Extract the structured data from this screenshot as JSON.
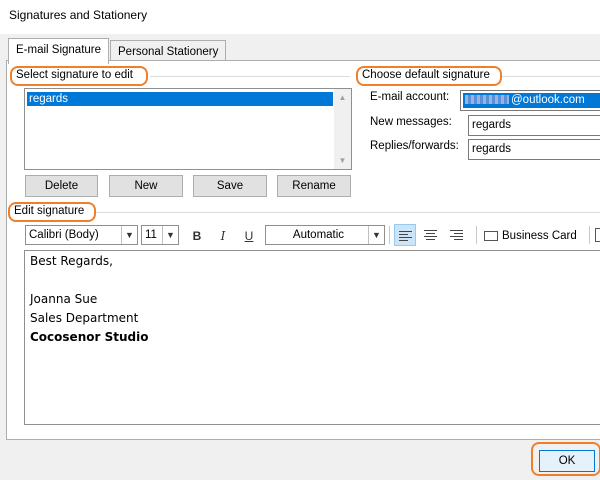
{
  "window": {
    "title": "Signatures and Stationery"
  },
  "tabs": [
    {
      "label": "E-mail Signature",
      "active": true
    },
    {
      "label": "Personal Stationery",
      "active": false
    }
  ],
  "select_signature": {
    "group_label": "Select signature to edit",
    "items": [
      "regards"
    ],
    "selected": "regards",
    "buttons": {
      "delete": "Delete",
      "new": "New",
      "save": "Save",
      "rename": "Rename"
    }
  },
  "default_signature": {
    "group_label": "Choose default signature",
    "email_account_label": "E-mail account:",
    "email_account_value": "@outlook.com",
    "new_messages_label": "New messages:",
    "new_messages_value": "regards",
    "replies_label": "Replies/forwards:",
    "replies_value": "regards"
  },
  "edit_signature": {
    "group_label": "Edit signature",
    "toolbar": {
      "font": "Calibri (Body)",
      "size": "11",
      "bold": "B",
      "italic": "I",
      "underline": "U",
      "color": "Automatic",
      "business_card": "Business Card",
      "alignment": "left"
    },
    "content_lines": [
      {
        "text": "Best Regards,",
        "bold": false
      },
      {
        "text": "",
        "bold": false
      },
      {
        "text": "Joanna Sue",
        "bold": false
      },
      {
        "text": "Sales Department",
        "bold": false
      },
      {
        "text": "Cocosenor Studio",
        "bold": true
      }
    ]
  },
  "footer": {
    "ok": "OK"
  },
  "colors": {
    "accent": "#0078d7",
    "highlight": "#f07f2c",
    "selection": "#0078d7"
  }
}
